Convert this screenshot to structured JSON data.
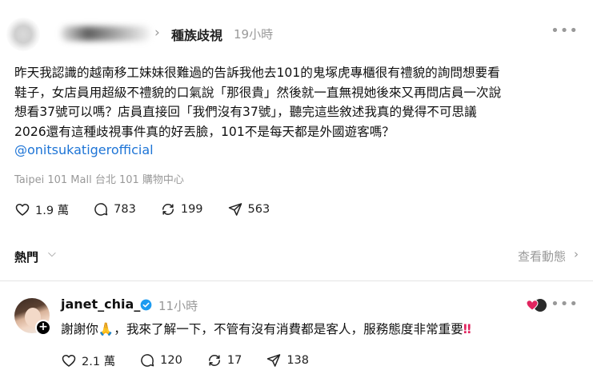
{
  "post": {
    "topic": "種族歧視",
    "time": "19小時",
    "more_icon": "more-horizontal-icon",
    "body_lines": [
      "昨天我認識的越南移工妹妹很難過的告訴我他去101的鬼塚虎專櫃很有禮貌的詢問想要看",
      "鞋子，女店員用超級不禮貌的口氣說「那很貴」然後就一直無視她後來又再問店員一次說",
      "想看37號可以嗎？店員直接回「我們沒有37號」，聽完這些敘述我真的覺得不可思議",
      "2026還有這種歧視事件真的好丟臉，101不是每天都是外國遊客嗎？"
    ],
    "mention": "@onitsukatigerofficial",
    "location": "Taipei 101 Mall 台北 101 購物中心",
    "stats": {
      "likes": "1.9 萬",
      "comments": "783",
      "reposts": "199",
      "shares": "563"
    }
  },
  "sort_bar": {
    "label": "熱門",
    "activity_link": "查看動態"
  },
  "reply": {
    "username": "janet_chia_",
    "time": "11小時",
    "text_part1": "謝謝你",
    "emoji": "🙏",
    "text_part2": "，我來了解一下，不管有沒有消費都是客人，服務態度非常重要",
    "end_mark": "‼",
    "stats": {
      "likes": "2.1 萬",
      "comments": "120",
      "reposts": "17",
      "shares": "138"
    }
  },
  "colors": {
    "link": "#1d74d6",
    "muted": "#999999",
    "verified": "#1d9bf0",
    "heart": "#e0245e"
  }
}
